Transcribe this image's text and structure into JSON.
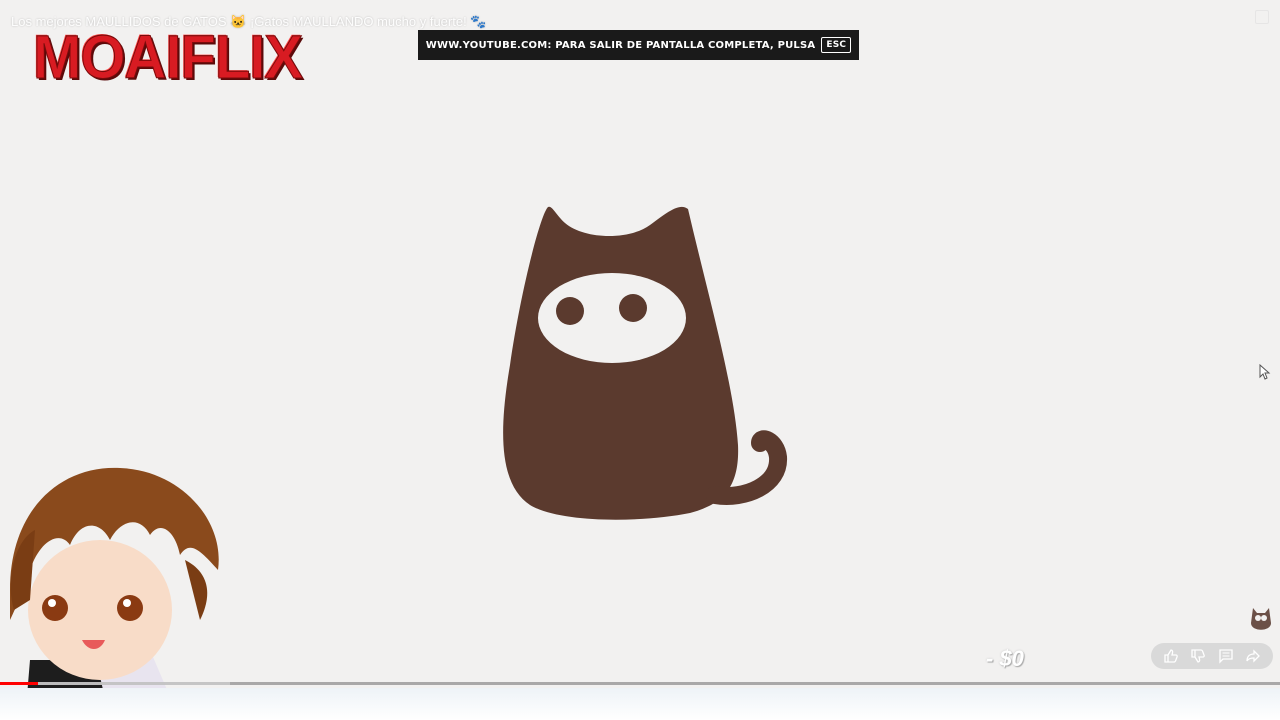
{
  "video": {
    "title": "Los mejores MAULLIDOS de GATOS 🐱 ¡Gatos MAULLANDO mucho y fuerte! 🐾",
    "progress_fraction": 0.03
  },
  "overlay": {
    "logo_text": "MOAIFLIX",
    "fullscreen_notice": "WWW.YOUTUBE.COM: PARA SALIR DE PANTALLA COMPLETA, PULSA",
    "esc_label": "ESC",
    "counter_text": "- $0"
  },
  "colors": {
    "cat_brown": "#5b3a2e",
    "logo_red": "#d81b22",
    "progress_red": "#ff0000",
    "background": "#f2f1f0"
  },
  "icons": [
    "like-icon",
    "dislike-icon",
    "comment-icon",
    "share-icon",
    "fullscreen-exit-icon",
    "cursor-icon"
  ]
}
